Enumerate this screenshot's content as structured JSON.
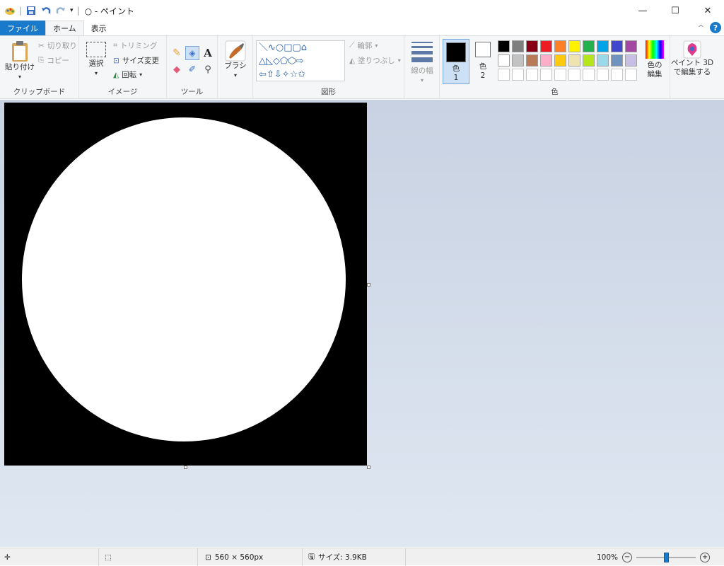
{
  "window": {
    "title": "○ - ペイント",
    "minimize": "—",
    "maximize": "☐",
    "close": "✕"
  },
  "tabs": {
    "file": "ファイル",
    "home": "ホーム",
    "view": "表示",
    "collapse": "^",
    "help": "?"
  },
  "clipboard": {
    "paste": "貼り付け",
    "cut": "切り取り",
    "copy": "コピー",
    "group": "クリップボード"
  },
  "image": {
    "select": "選択",
    "crop": "トリミング",
    "resize": "サイズ変更",
    "rotate": "回転",
    "group": "イメージ"
  },
  "tools": {
    "group": "ツール",
    "text_glyph": "A"
  },
  "brushes": {
    "label": "ブラシ"
  },
  "shapes": {
    "outline": "輪郭",
    "fill": "塗りつぶし",
    "group": "図形",
    "row1": "＼∿○□▢⌂",
    "row2": "△◺◇⬠⬡⇨",
    "row3": "⇦⇧⇩✧☆✩"
  },
  "size": {
    "label": "線の幅"
  },
  "colors": {
    "color1_label": "色",
    "color1_num": "1",
    "color2_label": "色",
    "color2_num": "2",
    "edit": "色の\n編集",
    "group": "色",
    "paint3d": "ペイント 3D\nで編集する",
    "palette_row1": [
      "#000000",
      "#7f7f7f",
      "#880015",
      "#ed1c24",
      "#ff7f27",
      "#fff200",
      "#22b14c",
      "#00a2e8",
      "#3f48cc",
      "#a349a4"
    ],
    "palette_row2": [
      "#ffffff",
      "#c3c3c3",
      "#b97a57",
      "#ffaec9",
      "#ffc90e",
      "#efe4b0",
      "#b5e61d",
      "#99d9ea",
      "#7092be",
      "#c8bfe7"
    ]
  },
  "status": {
    "dimensions": "560 × 560px",
    "size": "サイズ: 3.9KB",
    "zoom": "100%",
    "zoom_minus": "−",
    "zoom_plus": "+",
    "zoom_level": 0.5
  }
}
